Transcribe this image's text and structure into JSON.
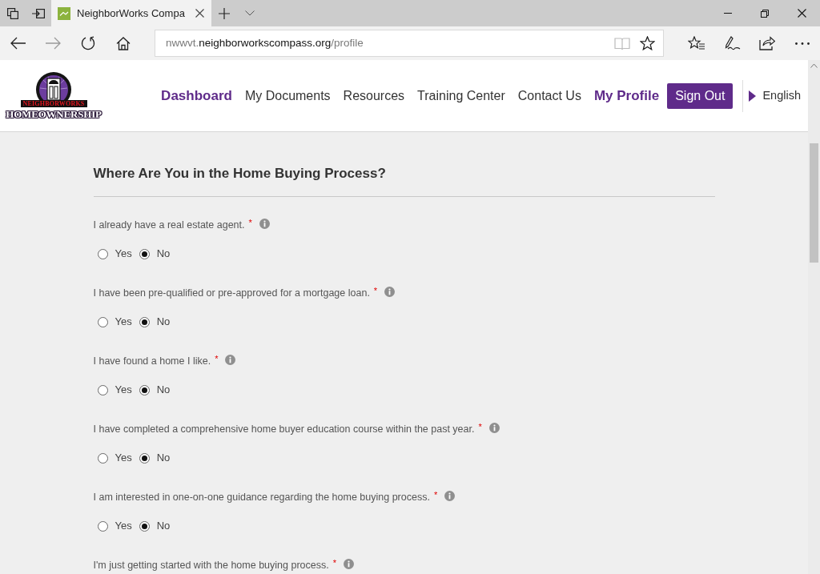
{
  "browser": {
    "tabs": [
      {
        "title": "NeighborWorks Compa",
        "selected": true
      }
    ],
    "address": "nwwvt.**neighborworkscompass.org**/profile"
  },
  "site_header": {
    "logo": {
      "banner": "NEIGHBORWORKS",
      "wordmark": "HOMEOWNERSHIP"
    },
    "nav": [
      {
        "label": "Dashboard",
        "highlighted": true
      },
      {
        "label": "My Documents",
        "highlighted": false
      },
      {
        "label": "Resources",
        "highlighted": false
      },
      {
        "label": "Training Center",
        "highlighted": false
      },
      {
        "label": "Contact Us",
        "highlighted": false
      },
      {
        "label": "My Profile",
        "highlighted": true
      }
    ],
    "sign_out": "Sign Out",
    "language": "English"
  },
  "form": {
    "title": "Where Are You in the Home Buying Process?",
    "questions": [
      {
        "text": "I already have a real estate agent.",
        "required_mark": "*",
        "options": [
          {
            "label": "Yes",
            "selected": false
          },
          {
            "label": "No",
            "selected": true
          }
        ]
      },
      {
        "text": "I have been pre-qualified or pre-approved for a mortgage loan.",
        "required_mark": "*",
        "options": [
          {
            "label": "Yes",
            "selected": false
          },
          {
            "label": "No",
            "selected": true
          }
        ]
      },
      {
        "text": "I have found a home I like.",
        "required_mark": "*",
        "options": [
          {
            "label": "Yes",
            "selected": false
          },
          {
            "label": "No",
            "selected": true
          }
        ]
      },
      {
        "text": "I have completed a comprehensive home buyer education course within the past year.",
        "required_mark": "*",
        "options": [
          {
            "label": "Yes",
            "selected": false
          },
          {
            "label": "No",
            "selected": true
          }
        ]
      },
      {
        "text": "I am interested in one-on-one guidance regarding the home buying process.",
        "required_mark": "*",
        "options": [
          {
            "label": "Yes",
            "selected": false
          },
          {
            "label": "No",
            "selected": true
          }
        ]
      },
      {
        "text": "I'm just getting started with the home buying process.",
        "required_mark": "*"
      }
    ]
  }
}
